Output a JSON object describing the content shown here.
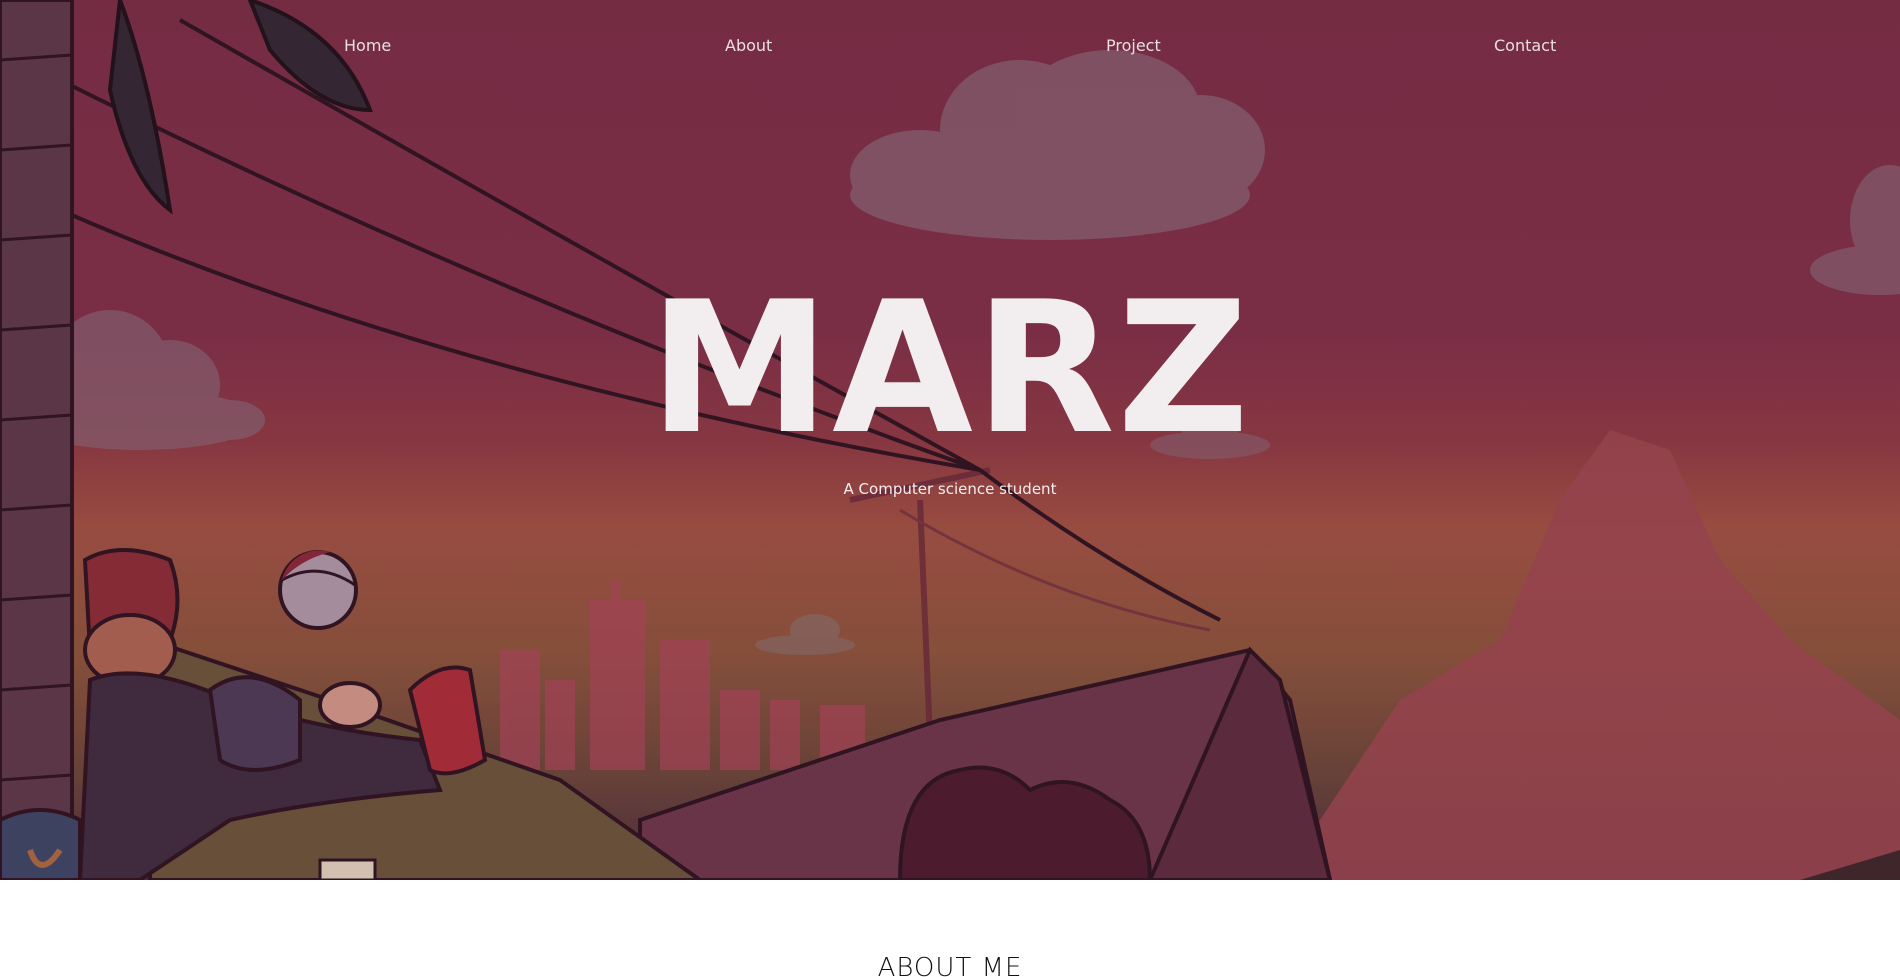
{
  "nav": {
    "items": [
      {
        "label": "Home"
      },
      {
        "label": "About"
      },
      {
        "label": "Project"
      },
      {
        "label": "Contact"
      }
    ]
  },
  "hero": {
    "title": "MARZ",
    "subtitle": "A Computer science student"
  },
  "about": {
    "heading": "ABOUT ME"
  },
  "colors": {
    "hero_top": "#7a3147",
    "hero_mid": "#a35644",
    "hero_bottom": "#4b3040",
    "title_text": "#f2eeef",
    "nav_text": "#e9dfe3",
    "page_background": "#ffffff"
  }
}
